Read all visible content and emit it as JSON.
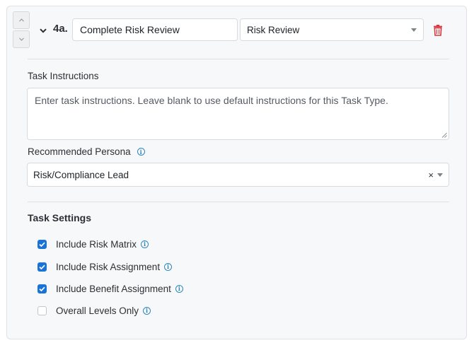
{
  "step": {
    "number": "4a.",
    "name_value": "Complete Risk Review",
    "type_selected": "Risk Review"
  },
  "instructions": {
    "label": "Task Instructions",
    "placeholder": "Enter task instructions. Leave blank to use default instructions for this Task Type."
  },
  "persona": {
    "label": "Recommended Persona",
    "selected": "Risk/Compliance Lead",
    "clear_glyph": "×"
  },
  "settings": {
    "title": "Task Settings",
    "options": [
      {
        "label": "Include Risk Matrix",
        "checked": true
      },
      {
        "label": "Include Risk Assignment",
        "checked": true
      },
      {
        "label": "Include Benefit Assignment",
        "checked": true
      },
      {
        "label": "Overall Levels Only",
        "checked": false
      }
    ]
  },
  "icons": {
    "move_up": "chevron-up-icon",
    "move_down": "chevron-down-icon",
    "collapse": "chevron-down-icon",
    "delete": "trash-icon",
    "info": "info-icon",
    "check": "check-icon"
  },
  "colors": {
    "accent": "#1a73d9",
    "danger": "#d9363e",
    "info": "#2f87b8"
  }
}
